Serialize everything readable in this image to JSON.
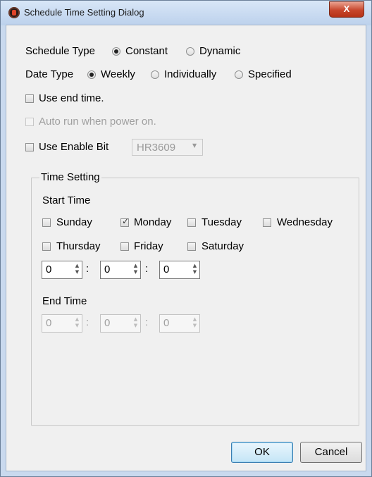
{
  "window": {
    "title": "Schedule Time Setting Dialog",
    "close_label": "X"
  },
  "schedule_type": {
    "label": "Schedule Type",
    "options": [
      "Constant",
      "Dynamic"
    ],
    "selected": "Constant"
  },
  "date_type": {
    "label": "Date Type",
    "options": [
      "Weekly",
      "Individually",
      "Specified"
    ],
    "selected": "Weekly"
  },
  "use_end_time": {
    "label": "Use end time.",
    "checked": false
  },
  "auto_run": {
    "label": "Auto run when power on.",
    "checked": false,
    "enabled": false
  },
  "use_enable_bit": {
    "label": "Use Enable Bit",
    "checked": false,
    "combo_value": "HR3609"
  },
  "time_setting": {
    "group_label": "Time Setting",
    "start_label": "Start Time",
    "days": [
      {
        "label": "Sunday",
        "checked": false
      },
      {
        "label": "Monday",
        "checked": true
      },
      {
        "label": "Tuesday",
        "checked": false
      },
      {
        "label": "Wednesday",
        "checked": false
      },
      {
        "label": "Thursday",
        "checked": false
      },
      {
        "label": "Friday",
        "checked": false
      },
      {
        "label": "Saturday",
        "checked": false
      }
    ],
    "start": {
      "hour": "0",
      "minute": "0",
      "second": "0"
    },
    "separator": ":",
    "end_label": "End Time",
    "end": {
      "hour": "0",
      "minute": "0",
      "second": "0",
      "enabled": false
    }
  },
  "buttons": {
    "ok": "OK",
    "cancel": "Cancel"
  }
}
